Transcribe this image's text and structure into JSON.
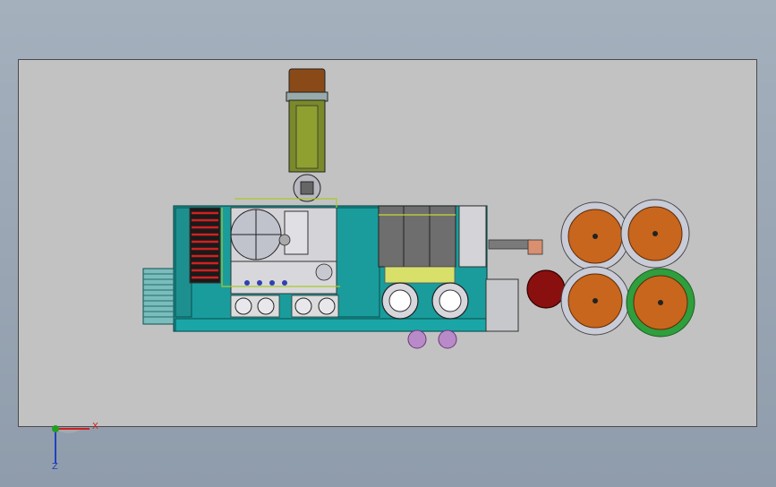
{
  "viewport": {
    "background": "#98a4b2"
  },
  "sheet": {
    "background": "#c2c2c2"
  },
  "colors": {
    "frame_teal": "#1a9c9c",
    "drum_orange": "#c8661e",
    "drum_rim": "#c9cbd6",
    "gear_green": "#2f9e3c",
    "tank_olive": "#7a8a2a",
    "motor_red": "#8a1010",
    "purple_part": "#b88ac8"
  },
  "triad": {
    "x_label": "X",
    "z_label": "Z",
    "x_color": "#d02020",
    "y_color": "#20a020",
    "z_color": "#2040c0"
  }
}
